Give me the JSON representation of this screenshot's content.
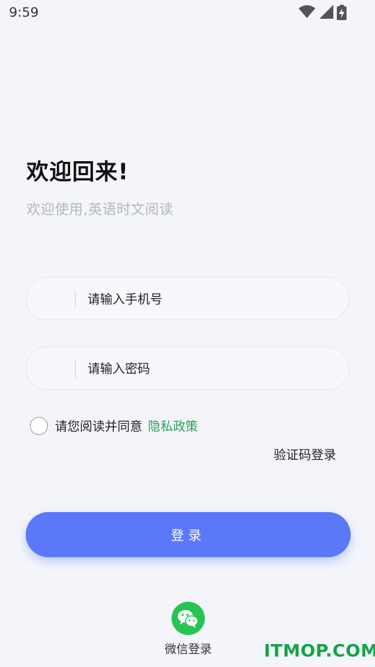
{
  "status_bar": {
    "time": "9:59",
    "icons": [
      "wifi-icon",
      "signal-icon",
      "battery-charging-icon"
    ]
  },
  "welcome": {
    "title": "欢迎回来!",
    "subtitle": "欢迎使用,英语时文阅读"
  },
  "form": {
    "phone_placeholder": "请输入手机号",
    "password_placeholder": "请输入密码"
  },
  "agreement": {
    "text": "请您阅读并同意",
    "link": "隐私政策",
    "checked": false
  },
  "code_login_label": "验证码登录",
  "login_button_label": "登录",
  "wechat": {
    "label": "微信登录",
    "icon": "wechat-icon"
  },
  "watermark": "ITMOP.COM",
  "colors": {
    "accent": "#5a78f8",
    "privacy_link": "#2f9d5e",
    "wechat": "#27c452",
    "watermark": "#16a34a"
  }
}
